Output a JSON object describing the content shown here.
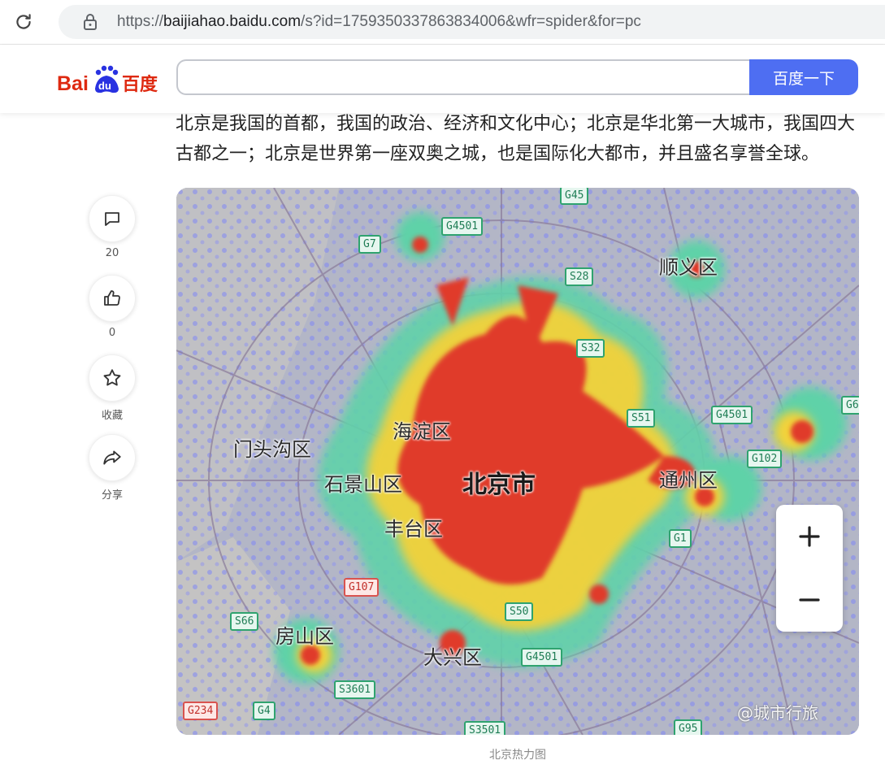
{
  "browser": {
    "url_host": "baijiahao.baidu.com",
    "url_path": "/s?id=1759350337863834006&wfr=spider&for=pc"
  },
  "header": {
    "logo_text": "Bai du 百度",
    "search_placeholder": "",
    "search_button": "百度一下"
  },
  "article": {
    "paragraph": "北京是我国的首都，我国的政治、经济和文化中心；北京是华北第一大城市，我国四大古都之一；北京是世界第一座双奥之城，也是国际化大都市，并且盛名享誉全球。"
  },
  "side_actions": [
    {
      "icon": "comment-icon",
      "label": "20"
    },
    {
      "icon": "like-icon",
      "label": "0"
    },
    {
      "icon": "star-icon",
      "label": "收藏"
    },
    {
      "icon": "share-icon",
      "label": "分享"
    }
  ],
  "map": {
    "districts": {
      "center": "北京市",
      "haidian": "海淀区",
      "mentougou": "门头沟区",
      "shijingshan": "石景山区",
      "fengtai": "丰台区",
      "tongzhou": "通州区",
      "shunyi": "顺义区",
      "fangshan": "房山区",
      "daxing": "大兴区"
    },
    "roads": {
      "g45": "G45",
      "g4501_top": "G4501",
      "g7": "G7",
      "s28": "S28",
      "s32": "S32",
      "s51": "S51",
      "g4501_right": "G4501",
      "g102": "G102",
      "g1": "G1",
      "g107": "G107",
      "s66": "S66",
      "s50": "S50",
      "g4501_bottom": "G4501",
      "s3601": "S3601",
      "g234": "G234",
      "g4": "G4",
      "s3501": "S3501",
      "g95": "G95",
      "g6": "G6"
    },
    "zoom_in": "+",
    "zoom_out": "−",
    "watermark": "@城市行旅",
    "caption": "北京热力图"
  },
  "colors": {
    "accent": "#4e6ef2",
    "heat_core": "#e03a2c",
    "heat_mid": "#f2d23a",
    "heat_low": "#5fd2a8",
    "heat_faint": "#8c8ff0"
  }
}
